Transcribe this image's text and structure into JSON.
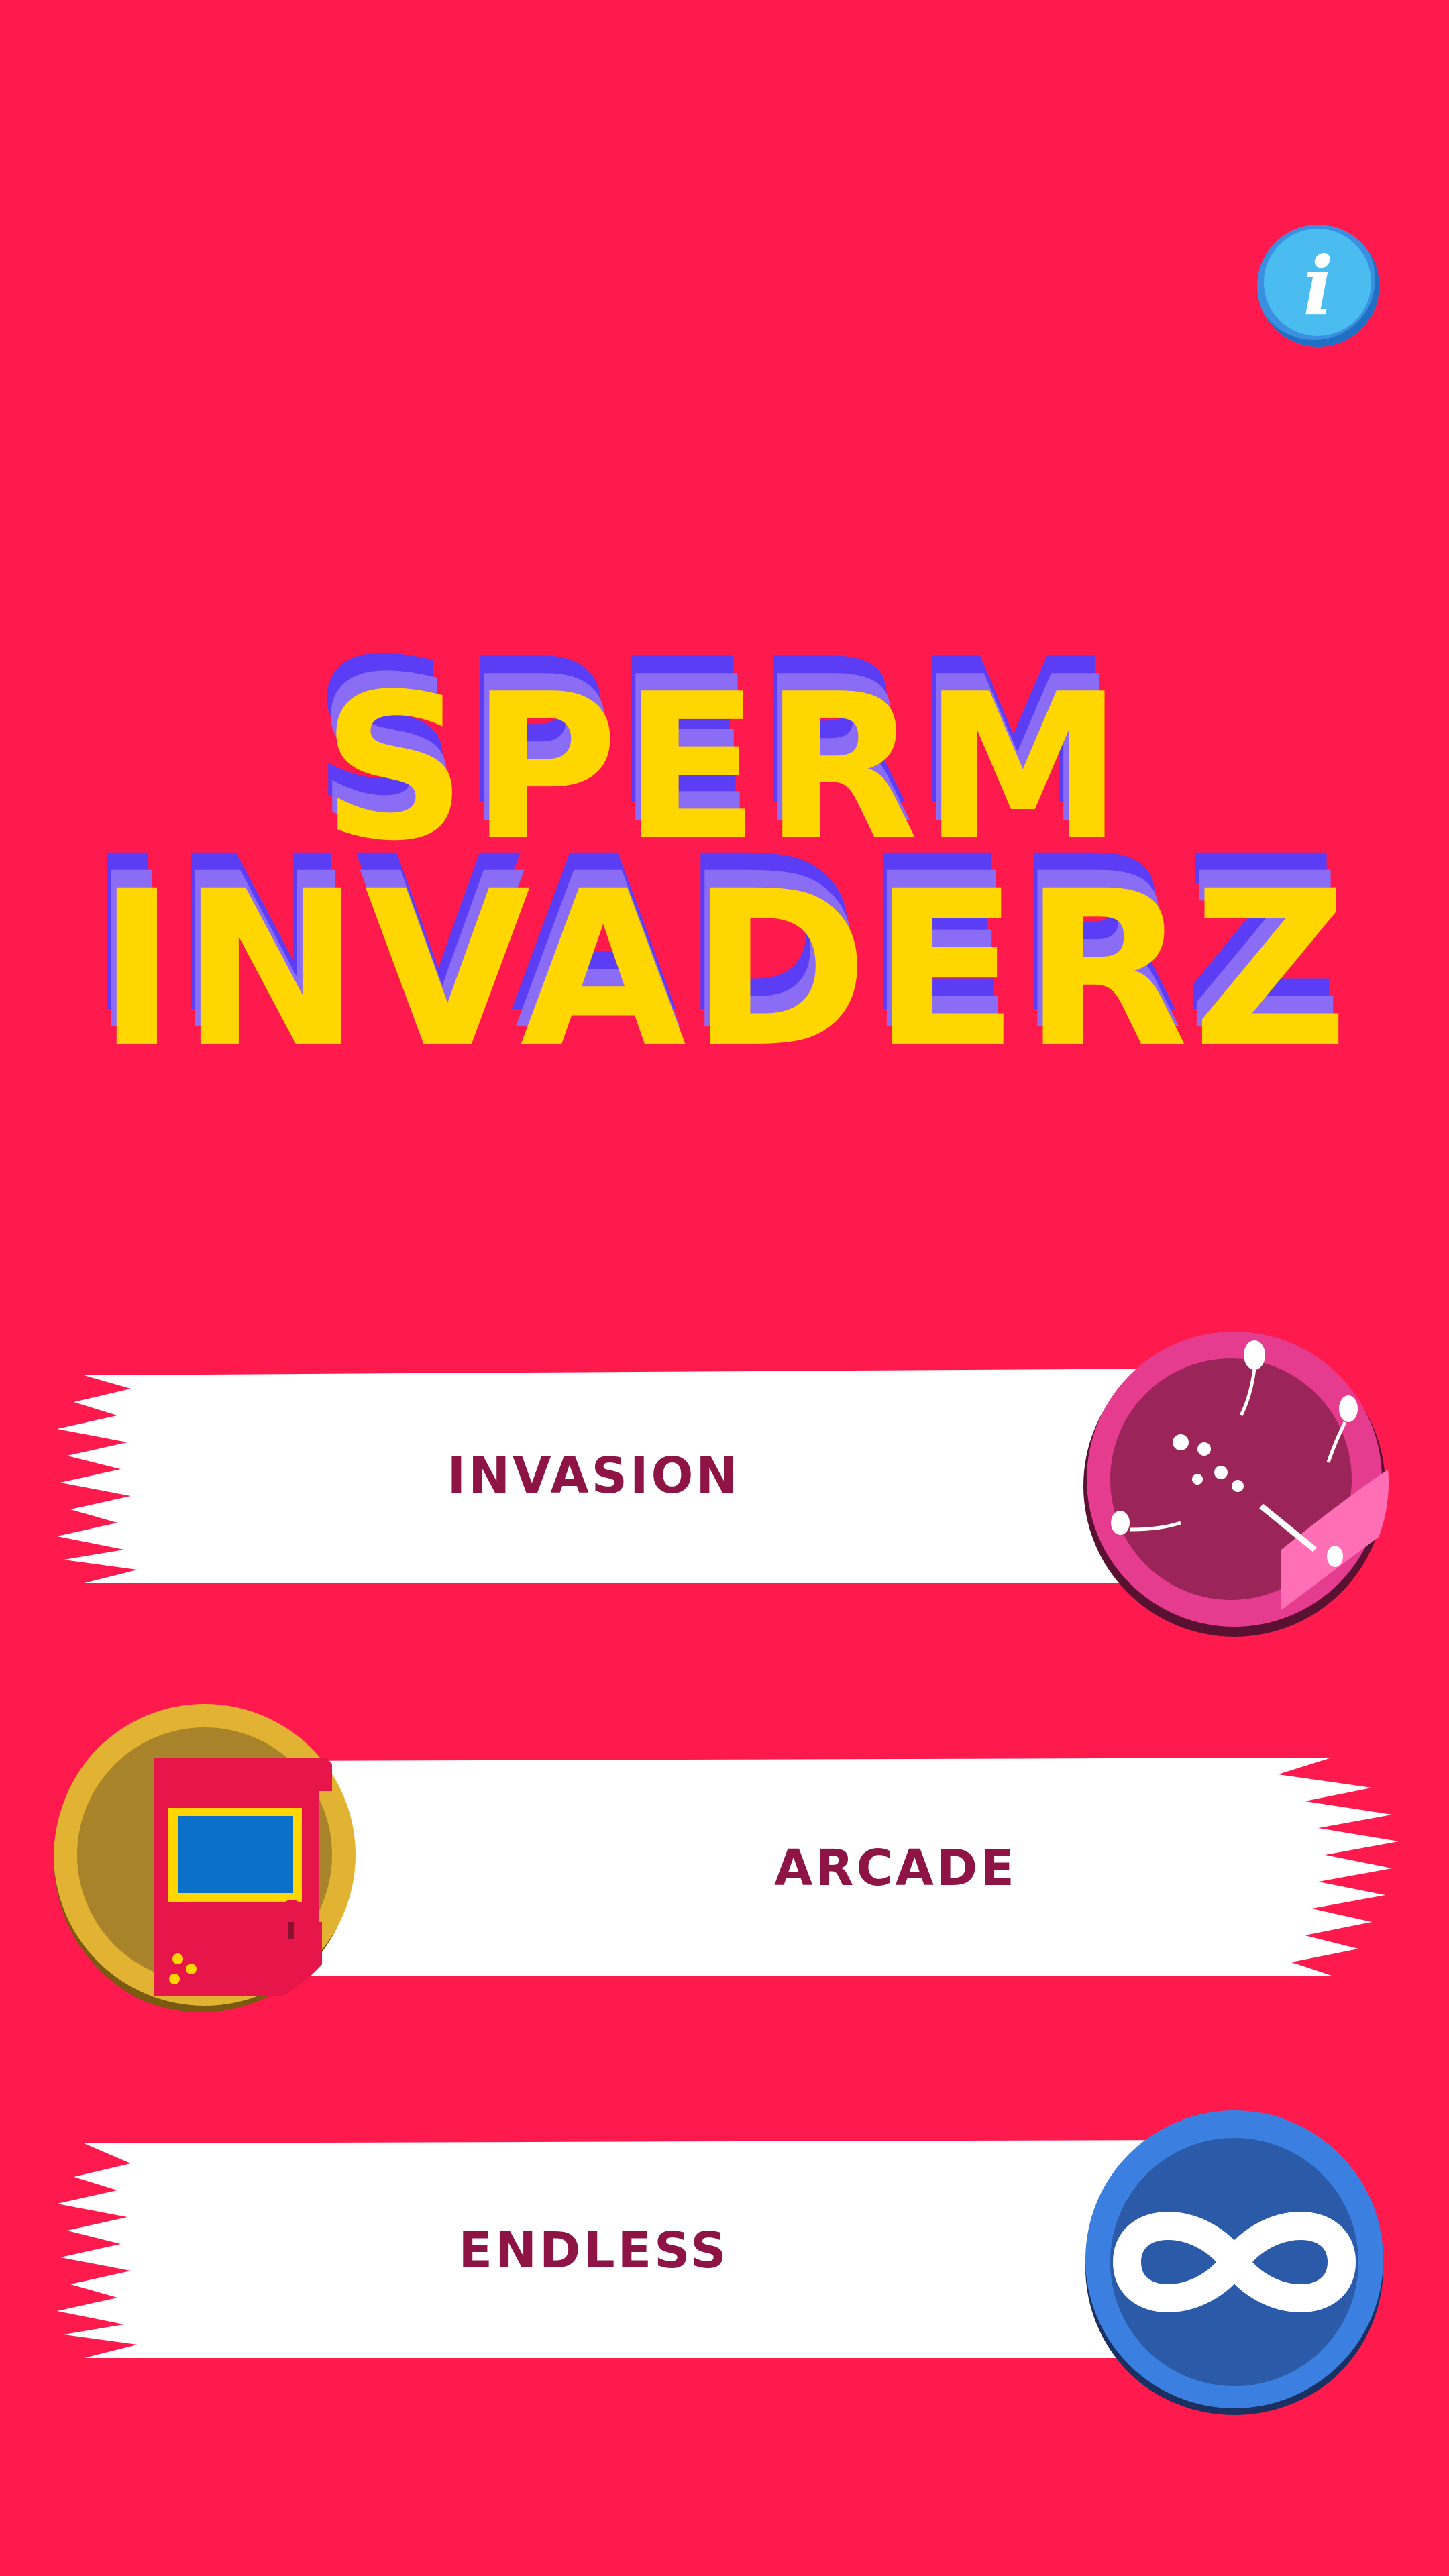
{
  "title": {
    "line1": "SPERM",
    "line2": "INVADERZ"
  },
  "info_button": {
    "glyph": "i",
    "icon": "info-icon"
  },
  "menu": [
    {
      "label": "INVASION",
      "icon": "egg-sperm-icon"
    },
    {
      "label": "ARCADE",
      "icon": "arcade-cabinet-icon"
    },
    {
      "label": "ENDLESS",
      "icon": "infinity-icon"
    }
  ],
  "colors": {
    "background": "#ff1a4e",
    "title_fill": "#ffd600",
    "title_shadow": "#7a5cf5",
    "label_text": "#8e1446",
    "info_blue": "#4bbcf0"
  }
}
